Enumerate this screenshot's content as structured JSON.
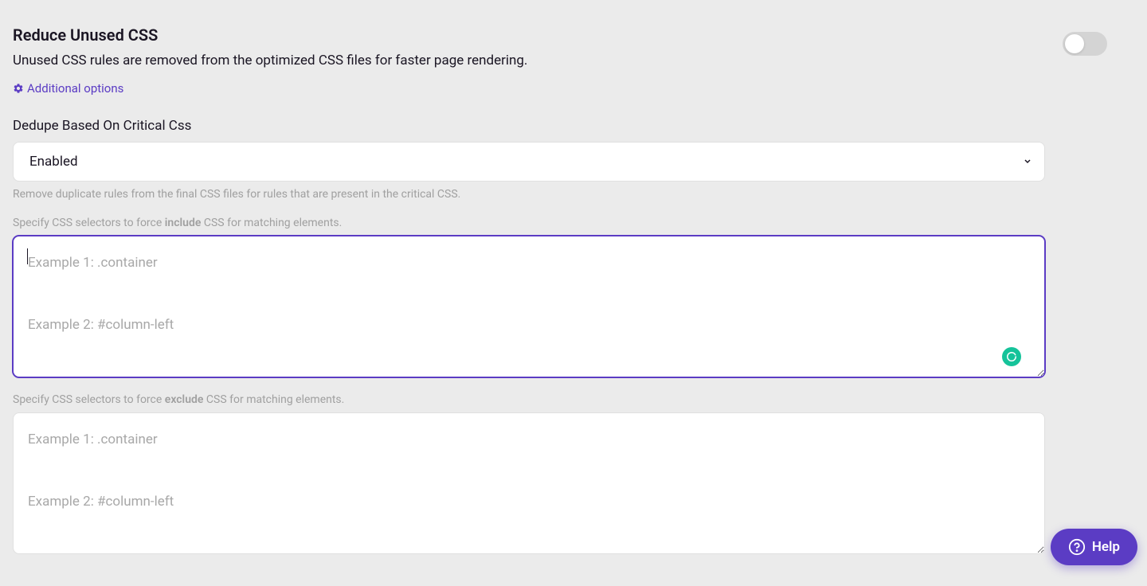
{
  "section": {
    "title": "Reduce Unused CSS",
    "description": "Unused CSS rules are removed from the optimized CSS files for faster page rendering.",
    "additional_options_label": "Additional options",
    "toggle_on": false
  },
  "dedupe": {
    "label": "Dedupe Based On Critical Css",
    "selected_value": "Enabled",
    "helper": "Remove duplicate rules from the final CSS files for rules that are present in the critical CSS."
  },
  "include_selectors": {
    "prompt_prefix": "Specify CSS selectors to force ",
    "prompt_bold": "include",
    "prompt_suffix": " CSS for matching elements.",
    "placeholder": "Example 1: .container\n\nExample 2: #column-left",
    "value": ""
  },
  "exclude_selectors": {
    "prompt_prefix": "Specify CSS selectors to force ",
    "prompt_bold": "exclude",
    "prompt_suffix": " CSS for matching elements.",
    "placeholder": "Example 1: .container\n\nExample 2: #column-left",
    "value": ""
  },
  "help": {
    "label": "Help"
  }
}
